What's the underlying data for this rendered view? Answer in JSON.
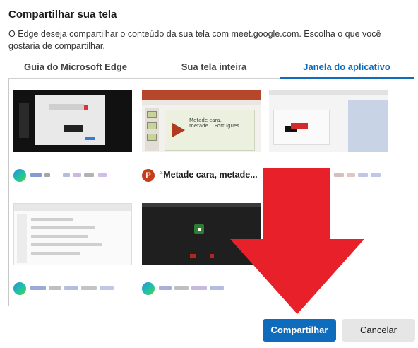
{
  "dialog": {
    "title": "Compartilhar sua tela",
    "description": "O Edge deseja compartilhar o conteúdo da sua tela com meet.google.com. Escolha o que você gostaria de compartilhar."
  },
  "tabs": [
    {
      "label": "Guia do Microsoft Edge",
      "selected": false
    },
    {
      "label": "Sua tela inteira",
      "selected": false
    },
    {
      "label": "Janela do aplicativo",
      "selected": true
    }
  ],
  "windows": [
    {
      "icon": "edge-icon",
      "label": ""
    },
    {
      "icon": "powerpoint-icon",
      "icon_text": "P",
      "label": "“Metade cara, metade..."
    },
    {
      "icon": "app-icon",
      "label": ""
    },
    {
      "icon": "edge-icon",
      "label": ""
    },
    {
      "icon": "edge-icon",
      "label": ""
    }
  ],
  "ppt_slide_text": "Metade cara, metade... Portugues",
  "buttons": {
    "share": "Compartilhar",
    "cancel": "Cancelar"
  },
  "colors": {
    "accent": "#0f6cbd",
    "overlay_arrow": "#e8202a"
  }
}
